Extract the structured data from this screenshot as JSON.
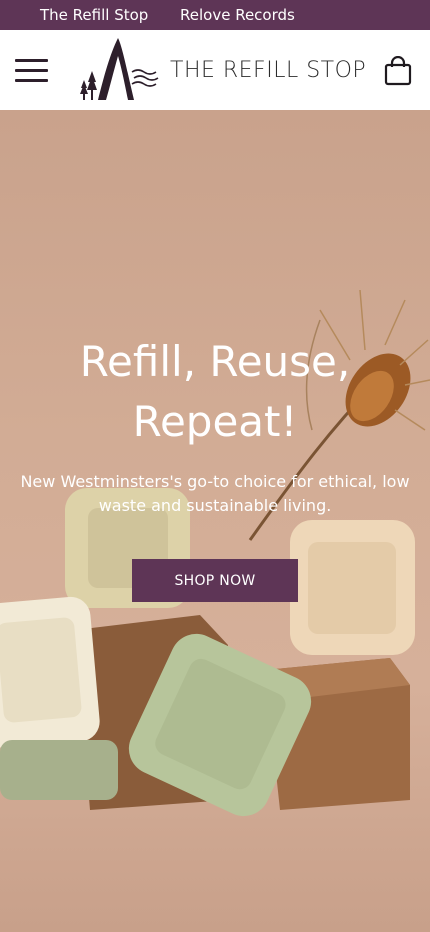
{
  "topbar": {
    "links": [
      "The Refill Stop",
      "Relove Records"
    ],
    "background": "#5e3556"
  },
  "header": {
    "brand_name": "THE REFILL STOP",
    "menu_icon": "hamburger-menu-icon",
    "cart_icon": "shopping-bag-icon"
  },
  "hero": {
    "title_line1": "Refill, Reuse,",
    "title_line2": "Repeat!",
    "subtitle": "New Westminsters's go-to choice for ethical, low waste and sustainable living.",
    "button_label": "SHOP NOW",
    "accent_color": "#5e3556"
  }
}
